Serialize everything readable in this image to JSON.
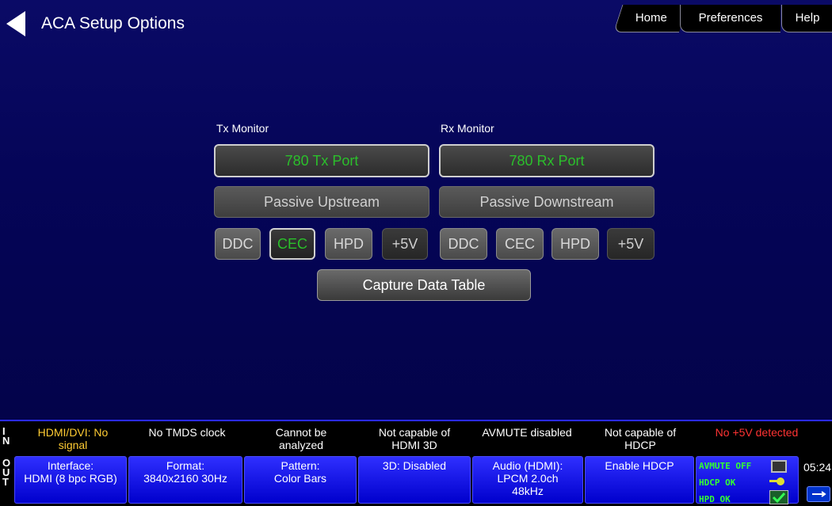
{
  "header": {
    "title": "ACA Setup Options",
    "nav": {
      "home": "Home",
      "preferences": "Preferences",
      "help": "Help"
    }
  },
  "tx": {
    "label": "Tx Monitor",
    "port": "780 Tx Port",
    "passive": "Passive Upstream",
    "signals": [
      {
        "label": "DDC",
        "state": "normal"
      },
      {
        "label": "CEC",
        "state": "active"
      },
      {
        "label": "HPD",
        "state": "normal"
      },
      {
        "label": "+5V",
        "state": "dark"
      }
    ]
  },
  "rx": {
    "label": "Rx Monitor",
    "port": "780 Rx Port",
    "passive": "Passive Downstream",
    "signals": [
      {
        "label": "DDC",
        "state": "normal"
      },
      {
        "label": "CEC",
        "state": "normal"
      },
      {
        "label": "HPD",
        "state": "normal"
      },
      {
        "label": "+5V",
        "state": "dark"
      }
    ]
  },
  "capture_button": "Capture Data Table",
  "in_bar": {
    "side_label": [
      "I",
      "N"
    ],
    "items": [
      {
        "text": [
          "HDMI/DVI: No",
          "signal"
        ],
        "color": "#ffcc33"
      },
      {
        "text": [
          "No TMDS clock"
        ],
        "color": "#ffffff"
      },
      {
        "text": [
          "Cannot be",
          "analyzed"
        ],
        "color": "#ffffff"
      },
      {
        "text": [
          "Not capable of",
          "HDMI 3D"
        ],
        "color": "#ffffff"
      },
      {
        "text": [
          "AVMUTE disabled"
        ],
        "color": "#ffffff"
      },
      {
        "text": [
          "Not capable of",
          "HDCP"
        ],
        "color": "#ffffff"
      },
      {
        "text": [
          "No +5V detected"
        ],
        "color": "#ff3333"
      }
    ]
  },
  "out_bar": {
    "side_label": [
      "O",
      "U",
      "T"
    ],
    "items": [
      [
        "Interface:",
        "HDMI (8 bpc RGB)"
      ],
      [
        "Format:",
        "3840x2160 30Hz"
      ],
      [
        "Pattern:",
        "Color Bars"
      ],
      [
        "3D: Disabled"
      ],
      [
        "Audio (HDMI):",
        "LPCM 2.0ch",
        "48kHz"
      ],
      [
        "Enable HDCP"
      ]
    ],
    "status": {
      "avmute": "AVMUTE OFF",
      "hdcp": "HDCP OK",
      "hpd": "HPD OK"
    },
    "clock": "05:24"
  }
}
